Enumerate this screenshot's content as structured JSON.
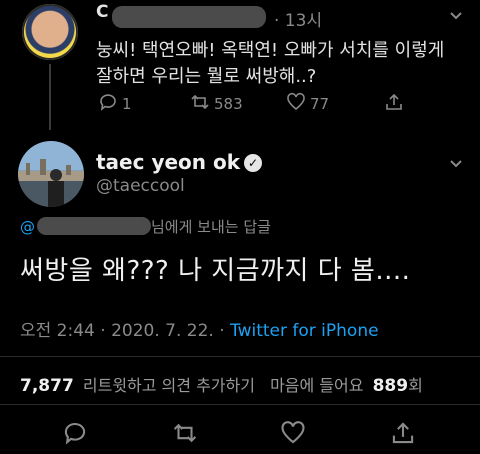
{
  "reply_tweet": {
    "author_initial": "C",
    "time": "· 13시",
    "text_line1": "눙씨! 택연오빠! 옥택연! 오빠가 서치를 이렇게",
    "text_line2": "잘하면 우리는 뭘로 써방해..?",
    "reply_count": "1",
    "retweet_count": "583",
    "like_count": "77"
  },
  "main_tweet": {
    "display_name": "taec yeon ok",
    "handle": "@taeccool",
    "replying_prefix": "@",
    "replying_suffix": "님에게 보내는 답글",
    "text": "써방을 왜??? 나 지금까지 다 봄....",
    "timestamp": "오전 2:44 · 2020. 7. 22. · ",
    "source": "Twitter for iPhone",
    "retweets_count": "7,877",
    "retweets_label": "리트윗하고 의견 추가하기",
    "likes_label": "마음에 들어요",
    "likes_count": "889",
    "likes_suffix": "회"
  },
  "colors": {
    "link": "#1da1f2",
    "background": "#000000",
    "muted": "#8a8a8a"
  },
  "icons": [
    "reply-icon",
    "retweet-icon",
    "like-icon",
    "share-icon",
    "chevron-down-icon",
    "verified-icon"
  ]
}
